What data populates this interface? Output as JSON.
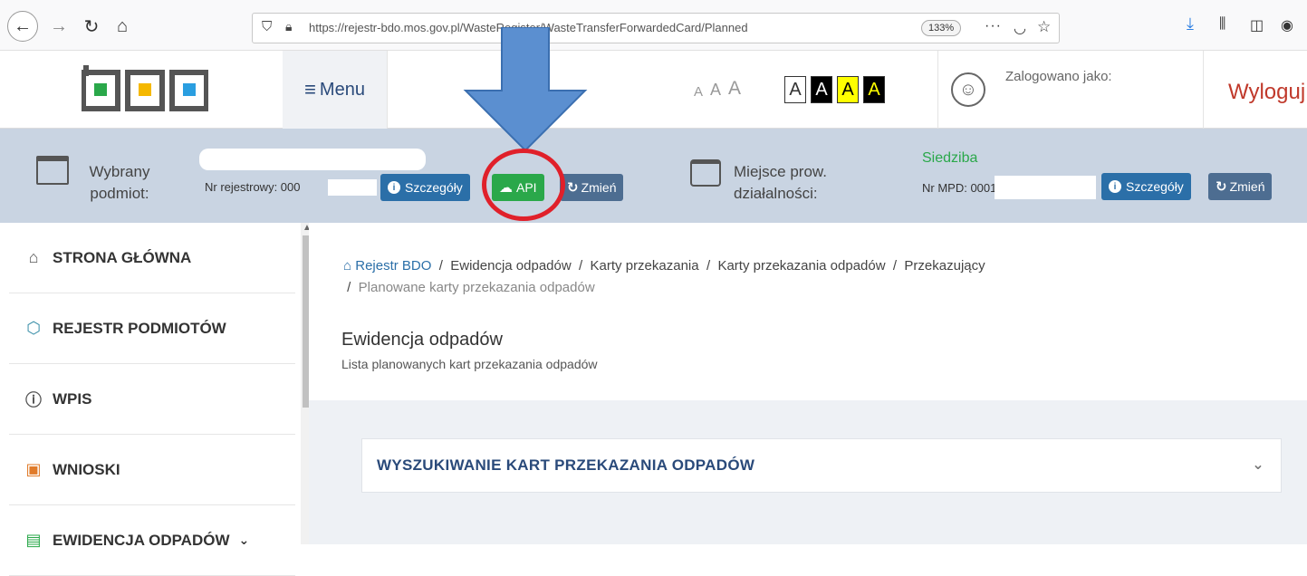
{
  "browser": {
    "url": "https://rejestr-bdo.mos.gov.pl/WasteRegister/WasteTransferForwardedCard/Planned",
    "zoom": "133%",
    "more": "···"
  },
  "header": {
    "menu_label": "Menu",
    "font_sizes": [
      "A",
      "A",
      "A"
    ],
    "contrast_options": [
      "A",
      "A",
      "A",
      "A"
    ],
    "logged_in_label": "Zalogowano jako:",
    "logout_label": "Wyloguj"
  },
  "context": {
    "entity_label": "Wybrany podmiot:",
    "nr_rejestrowy": "Nr rejestrowy: 000",
    "details_label": "Szczegóły",
    "api_label": "API",
    "change_label": "Zmień",
    "place_label": "Miejsce prow. działalności:",
    "siedziba": "Siedziba",
    "nr_mpd": "Nr MPD: 0001",
    "details2_label": "Szczegóły",
    "change2_label": "Zmień"
  },
  "sidebar": {
    "items": [
      {
        "label": "STRONA GŁÓWNA",
        "icon": "home-icon"
      },
      {
        "label": "REJESTR PODMIOTÓW",
        "icon": "cube-icon"
      },
      {
        "label": "WPIS",
        "icon": "info-circle-icon"
      },
      {
        "label": "WNIOSKI",
        "icon": "briefcase-icon"
      },
      {
        "label": "EWIDENCJA ODPADÓW",
        "icon": "archive-icon"
      }
    ]
  },
  "main": {
    "breadcrumb": {
      "home": "Rejestr BDO",
      "items": [
        "Ewidencja odpadów",
        "Karty przekazania",
        "Karty przekazania odpadów",
        "Przekazujący"
      ],
      "last": "Planowane karty przekazania odpadów"
    },
    "title": "Ewidencja odpadów",
    "subtitle": "Lista planowanych kart przekazania odpadów",
    "search_panel_title": "WYSZUKIWANIE KART PRZEKAZANIA ODPADÓW"
  },
  "colors": {
    "api_button": "#2aa84a",
    "info_button": "#2b6fa8",
    "change_button": "#4d6d91",
    "highlight_circle": "#e0202a",
    "arrow": "#5b8fd0",
    "logout": "#c0392b"
  }
}
